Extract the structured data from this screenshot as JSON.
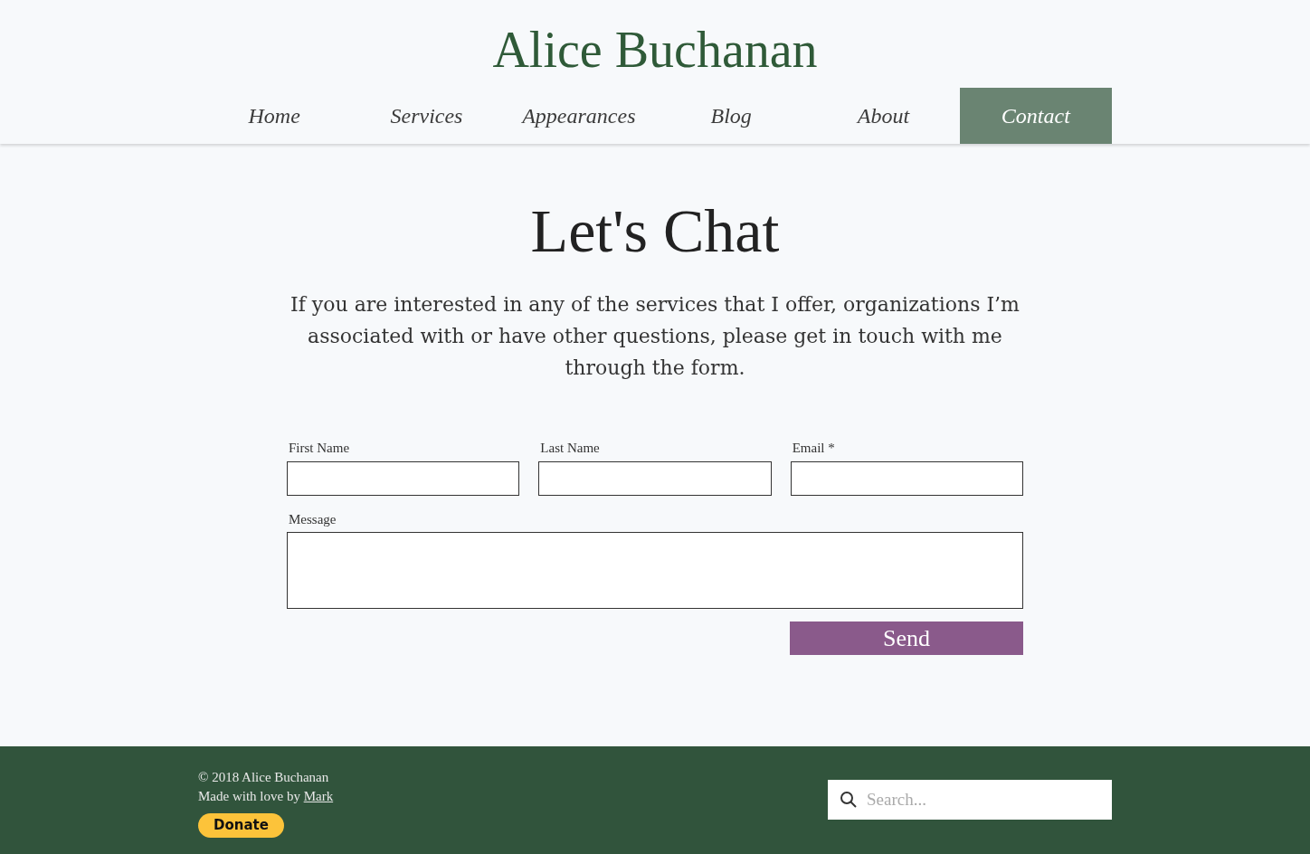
{
  "header": {
    "title": "Alice Buchanan"
  },
  "nav": [
    {
      "label": "Home",
      "selected": false
    },
    {
      "label": "Services",
      "selected": false
    },
    {
      "label": "Appearances",
      "selected": false
    },
    {
      "label": "Blog",
      "selected": false
    },
    {
      "label": "About",
      "selected": false
    },
    {
      "label": "Contact",
      "selected": true
    }
  ],
  "main": {
    "heading": "Let's Chat",
    "intro": "If you are interested in any of the services that I offer, organizations I’m associated with or have other questions, please get in touch with me through the form.",
    "form": {
      "fields": [
        {
          "label": "First Name",
          "kind": "input"
        },
        {
          "label": "Last Name",
          "kind": "input"
        },
        {
          "label": "Email *",
          "kind": "input"
        },
        {
          "label": "Message",
          "kind": "textarea"
        }
      ],
      "submit": "Send"
    }
  },
  "footer": {
    "copyright": "© 2018 Alice Buchanan",
    "credit_prefix": "Made with love by",
    "credit_link": "Mark",
    "donate": "Donate",
    "search": {
      "placeholder": "Search..."
    }
  }
}
